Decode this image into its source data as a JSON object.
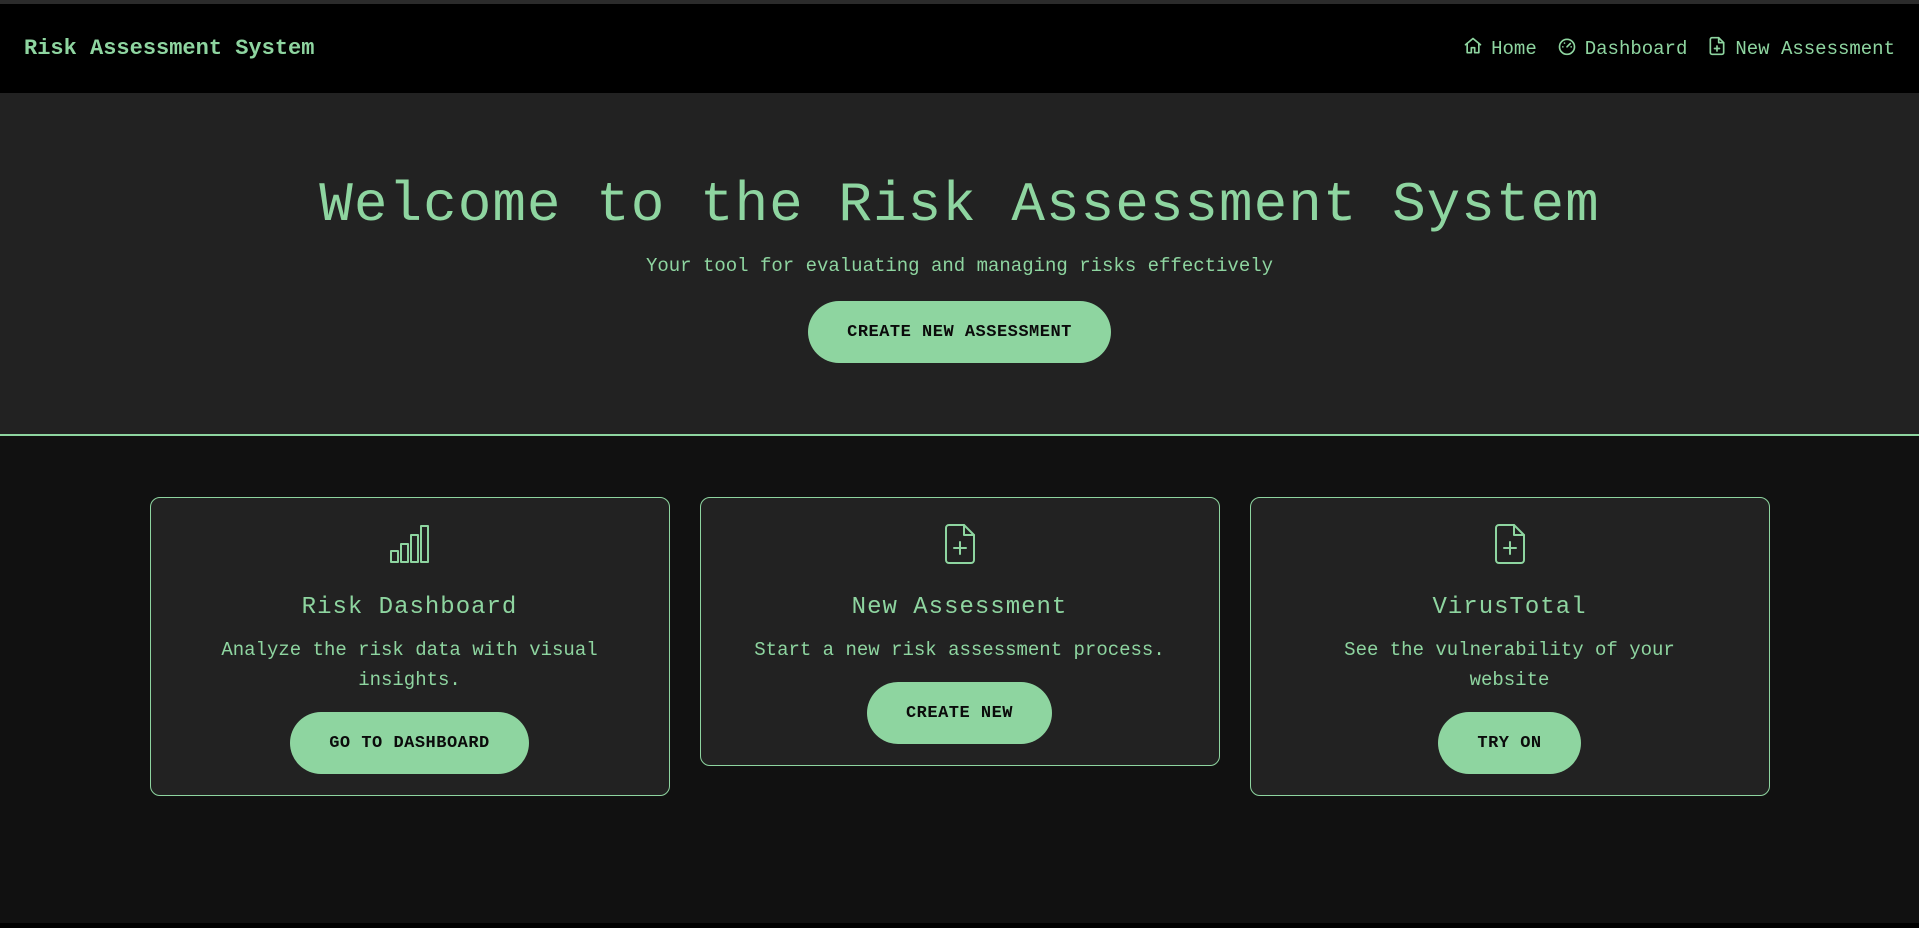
{
  "navbar": {
    "brand": "Risk Assessment System",
    "links": [
      {
        "label": "Home",
        "icon": "home-icon"
      },
      {
        "label": "Dashboard",
        "icon": "gauge-icon"
      },
      {
        "label": "New Assessment",
        "icon": "file-plus-icon"
      }
    ]
  },
  "hero": {
    "title": "Welcome to the Risk Assessment System",
    "subtitle": "Your tool for evaluating and managing risks effectively",
    "cta_label": "CREATE NEW ASSESSMENT"
  },
  "cards": [
    {
      "icon": "bar-chart-icon",
      "title": "Risk Dashboard",
      "description": "Analyze the risk data with visual insights.",
      "button_label": "GO TO DASHBOARD"
    },
    {
      "icon": "file-plus-icon",
      "title": "New Assessment",
      "description": "Start a new risk assessment process.",
      "button_label": "CREATE NEW"
    },
    {
      "icon": "file-plus-icon",
      "title": "VirusTotal",
      "description": "See the vulnerability of your website",
      "button_label": "TRY ON"
    }
  ],
  "colors": {
    "accent": "#8ed5a0",
    "navbar_bg": "#000000",
    "hero_bg": "#222222",
    "page_bg": "#111111",
    "card_bg": "#222222"
  }
}
